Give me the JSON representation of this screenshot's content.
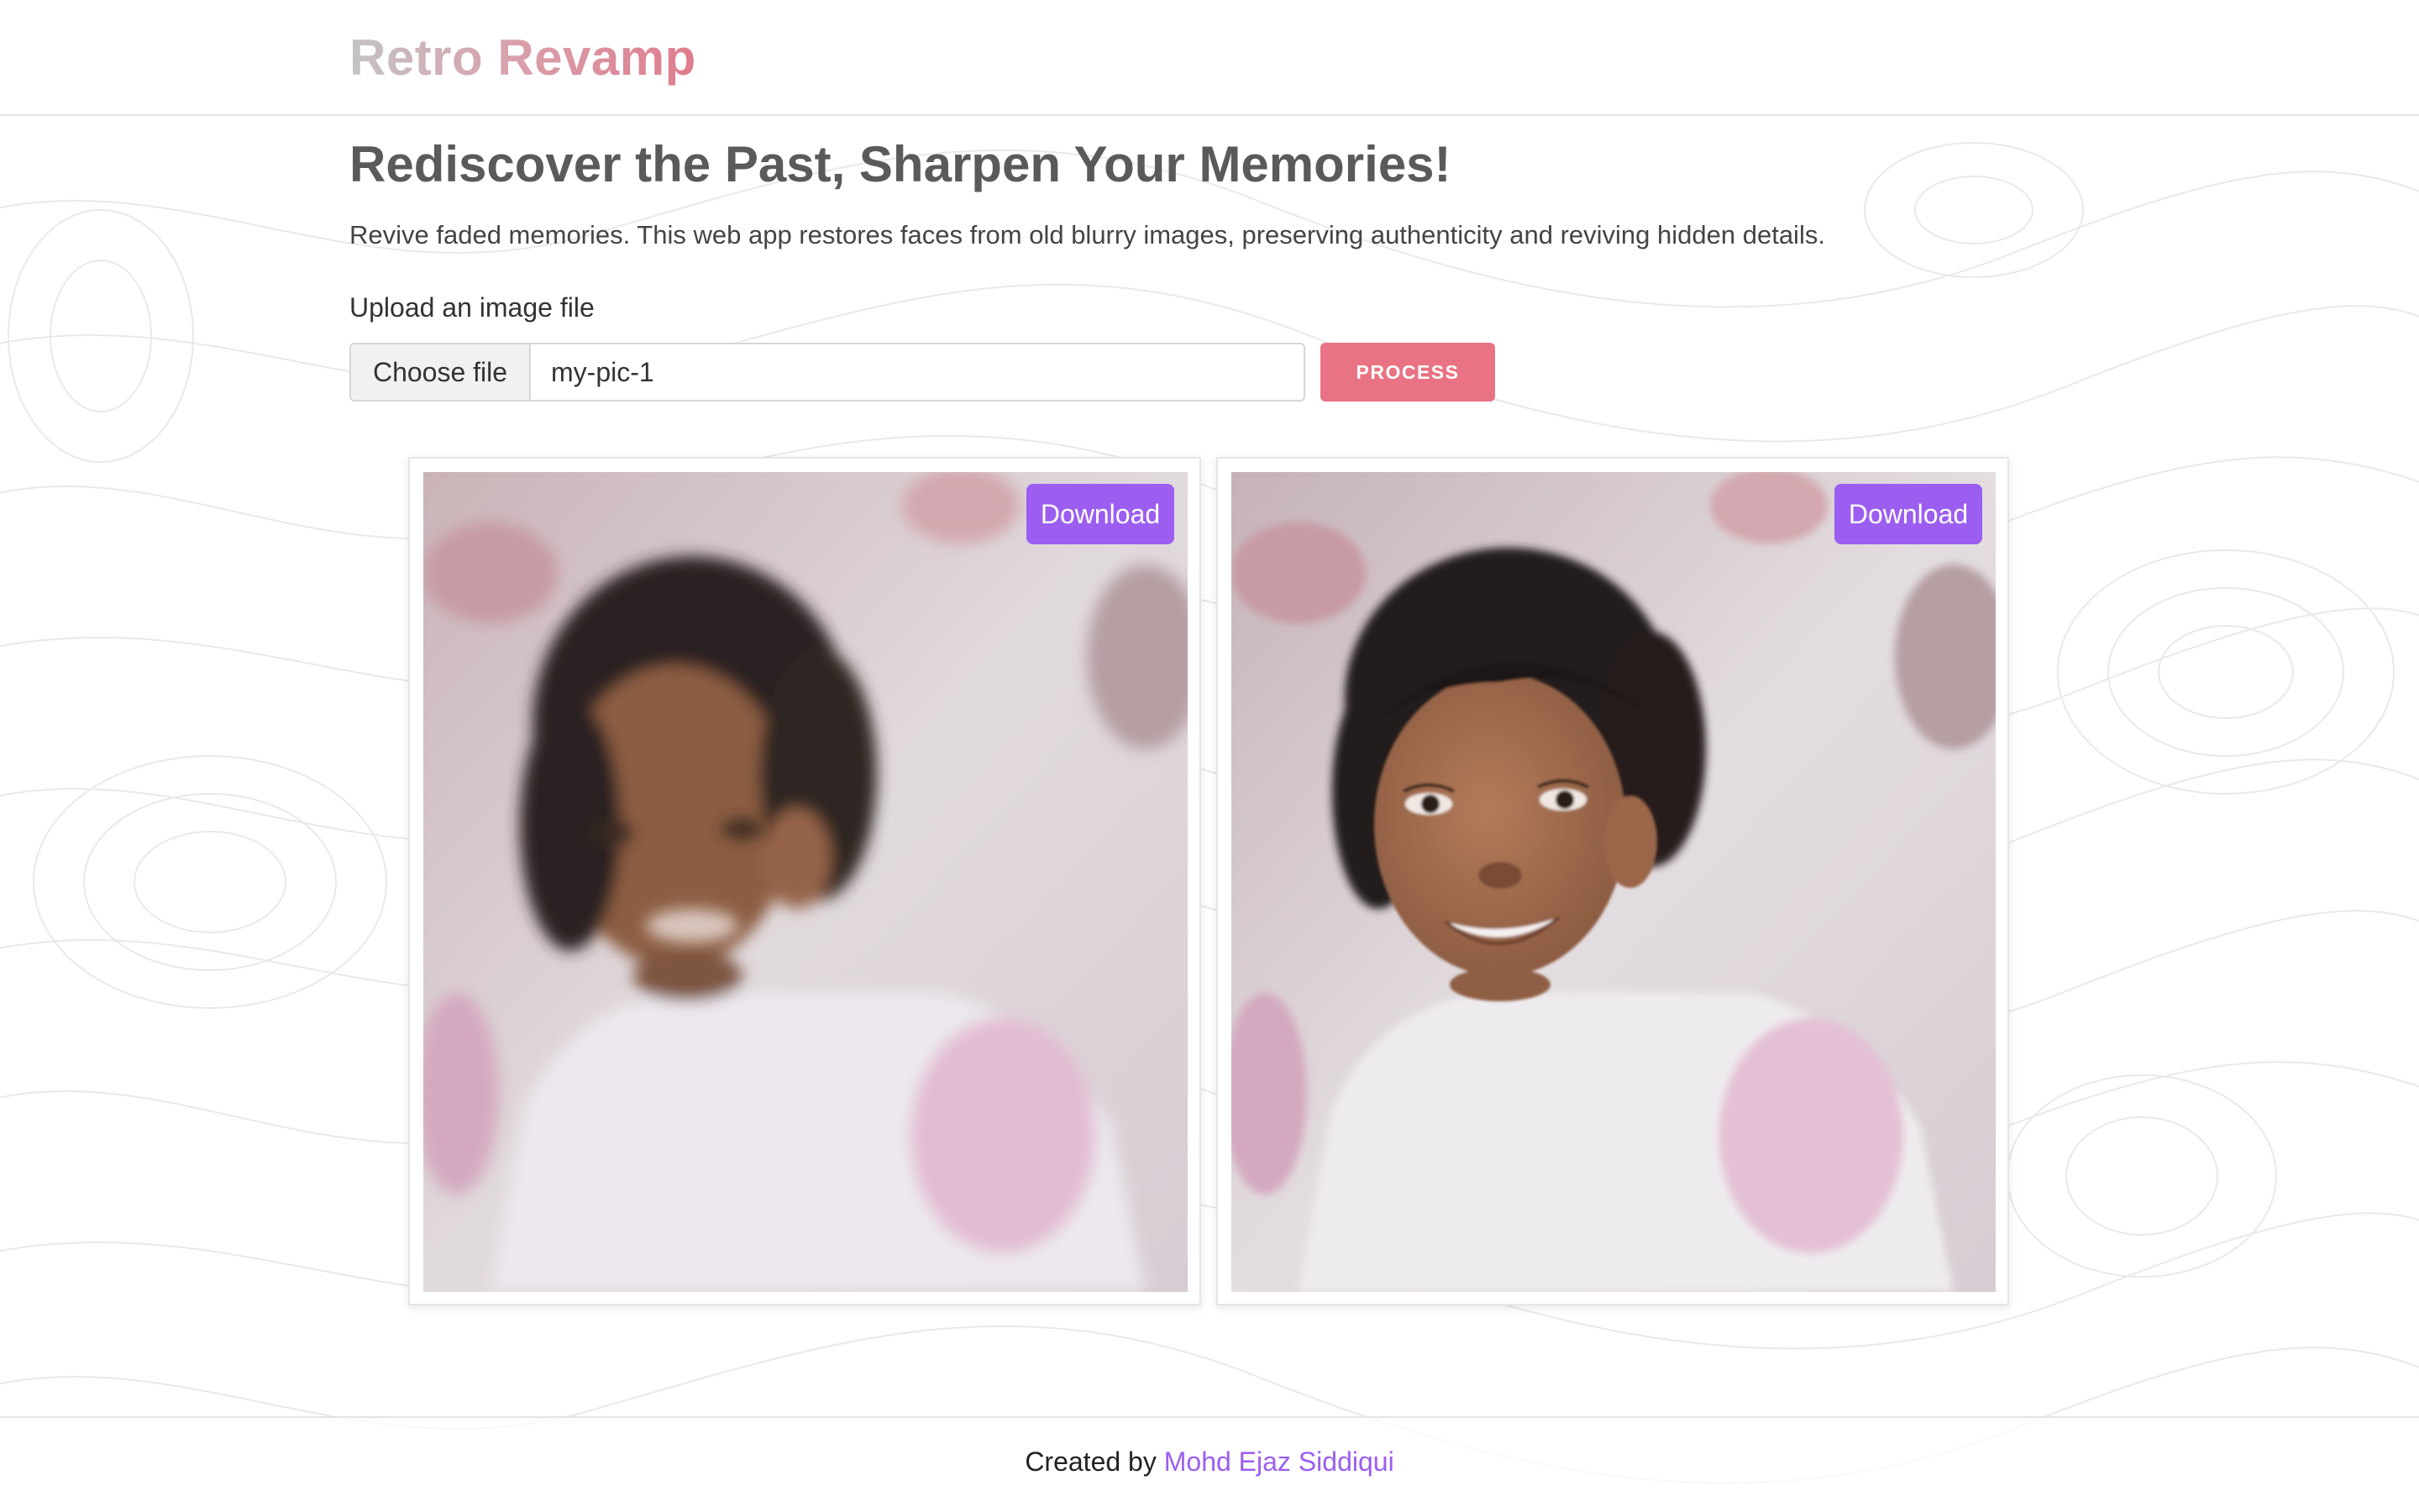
{
  "brand": {
    "title": "Retro Revamp"
  },
  "hero": {
    "headline": "Rediscover the Past, Sharpen Your Memories!",
    "tagline": "Revive faded memories. This web app restores faces from old blurry images, preserving authenticity and reviving hidden details."
  },
  "upload": {
    "label": "Upload an image file",
    "choose_label": "Choose file",
    "file_name": "my-pic-1",
    "process_label": "PROCESS"
  },
  "results": {
    "original_download_label": "Download",
    "restored_download_label": "Download"
  },
  "footer": {
    "prefix": "Created by",
    "author": "Mohd Ejaz Siddiqui"
  },
  "colors": {
    "accent_purple": "#9b5ef0",
    "process_pink": "#e97384",
    "headline_gray": "#5a5a5a"
  }
}
